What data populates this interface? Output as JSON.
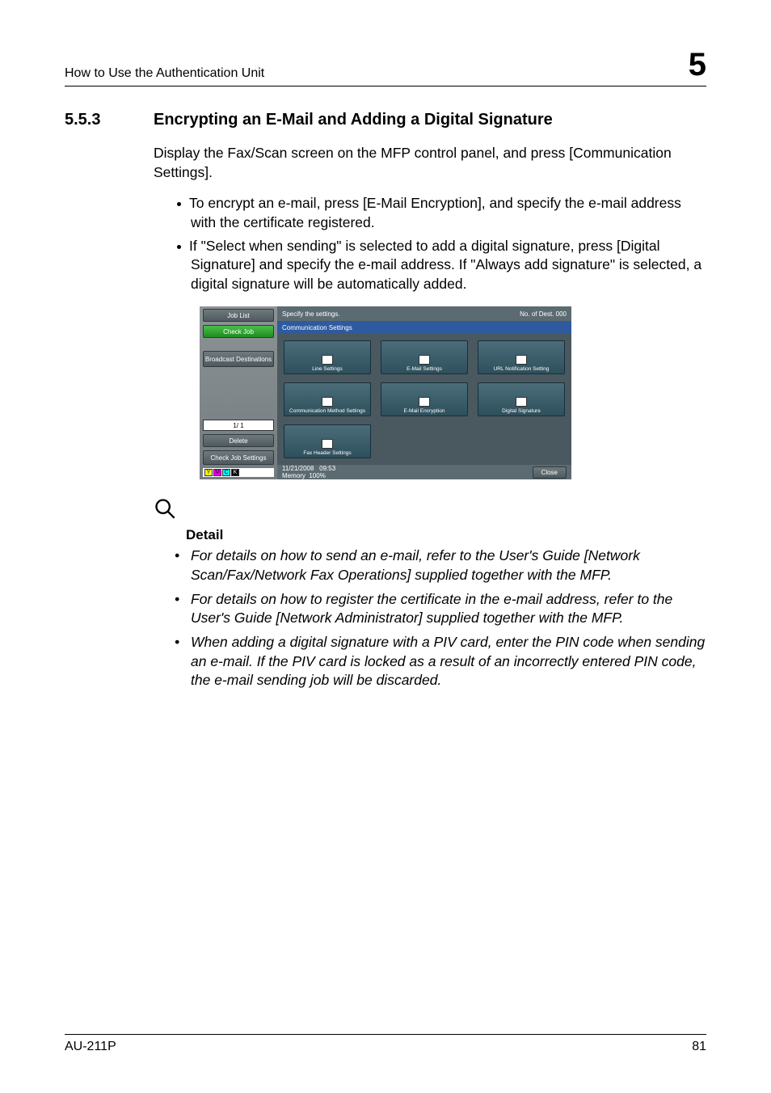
{
  "header": {
    "running_head": "How to Use the Authentication Unit",
    "chapter_number": "5"
  },
  "section": {
    "number": "5.5.3",
    "title": "Encrypting an E-Mail and Adding a Digital Signature"
  },
  "intro": "Display the Fax/Scan screen on the MFP control panel, and press [Communication Settings].",
  "bullets": [
    "To encrypt an e-mail, press [E-Mail Encryption], and specify the e-mail address with the certificate registered.",
    "If \"Select when sending\" is selected to add a digital signature, press [Digital Signature] and specify the e-mail address. If \"Always add signature\" is selected, a digital signature will be automatically added."
  ],
  "screenshot": {
    "left_tabs": {
      "job_list": "Job List",
      "check_job": "Check Job",
      "broadcast": "Broadcast Destinations",
      "page": "1/  1",
      "delete": "Delete",
      "check_job_settings": "Check Job Settings"
    },
    "topbar": {
      "prompt": "Specify the settings.",
      "dest_label": "No. of Dest.",
      "dest_count": "000"
    },
    "subbar": "Communication Settings",
    "buttons": {
      "line_settings": "Line Settings",
      "email_settings": "E-Mail Settings",
      "url_notify": "URL Notification Setting",
      "comm_method": "Communication Method Settings",
      "email_encrypt": "E-Mail Encryption",
      "digital_sig": "Digital Signature",
      "fax_header": "Fax Header Settings"
    },
    "footer": {
      "date": "11/21/2008",
      "time": "09:53",
      "memory_label": "Memory",
      "memory_val": "100%",
      "close": "Close"
    },
    "ymck": {
      "y": "Y",
      "m": "M",
      "c": "C",
      "k": "K"
    }
  },
  "detail": {
    "label": "Detail",
    "items": [
      "For details on how to send an e-mail, refer to the User's Guide [Network Scan/Fax/Network Fax Operations] supplied together with the MFP.",
      "For details on how to register the certificate in the e-mail address, refer to the User's Guide [Network Administrator] supplied together with the MFP.",
      "When adding a digital signature with a PIV card, enter the PIN code when sending an e-mail. If the PIV card is locked as a result of an incorrectly entered PIN code, the e-mail sending job will be discarded."
    ]
  },
  "footer": {
    "model": "AU-211P",
    "page": "81"
  }
}
